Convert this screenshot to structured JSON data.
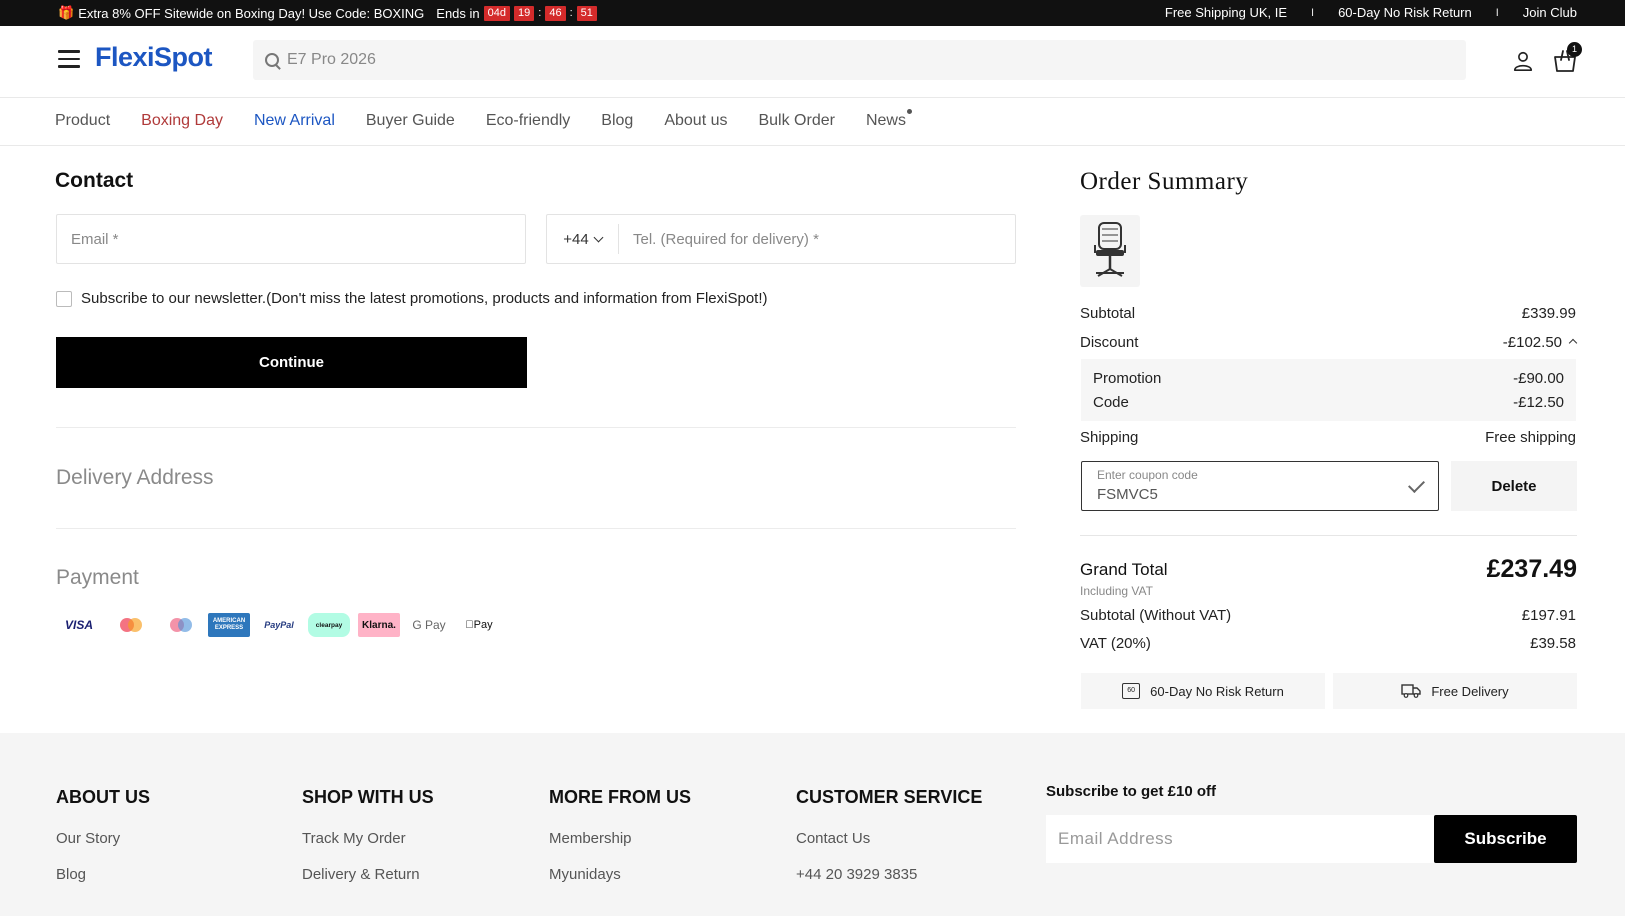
{
  "promo": {
    "gift_icon": "gift-icon",
    "text": "Extra 8% OFF Sitewide on Boxing Day! Use Code: BOXING",
    "ends_label": "Ends in",
    "timer": {
      "days": "04d",
      "hours": "19",
      "minutes": "46",
      "seconds": "51",
      "sep": ":"
    },
    "right_links": [
      "Free Shipping UK, IE",
      "60-Day No Risk Return",
      "Join Club"
    ],
    "pipe": "I"
  },
  "header": {
    "logo": "FlexiSpot",
    "search_placeholder": "E7 Pro 2026",
    "cart_count": "1"
  },
  "nav": {
    "items": [
      "Product",
      "Boxing Day",
      "New Arrival",
      "Buyer Guide",
      "Eco-friendly",
      "Blog",
      "About us",
      "Bulk Order",
      "News"
    ]
  },
  "contact": {
    "title": "Contact",
    "email_placeholder": "Email *",
    "country_code": "+44",
    "tel_placeholder": "Tel. (Required for delivery) *",
    "newsletter_text": "Subscribe to our newsletter.(Don't miss the latest promotions, products and information from FlexiSpot!)",
    "continue_label": "Continue"
  },
  "delivery": {
    "title": "Delivery Address"
  },
  "payment": {
    "title": "Payment",
    "methods": {
      "visa": "VISA",
      "amex": "AMERICAN EXPRESS",
      "paypal": "PayPal",
      "clearpay": "clearpay",
      "klarna": "Klarna.",
      "gpay": "G Pay",
      "apay": "Pay"
    }
  },
  "summary": {
    "title": "Order Summary",
    "subtotal_label": "Subtotal",
    "subtotal_value": "£339.99",
    "discount_label": "Discount",
    "discount_value": "-£102.50",
    "promotion_label": "Promotion",
    "promotion_value": "-£90.00",
    "code_label": "Code",
    "code_value": "-£12.50",
    "shipping_label": "Shipping",
    "shipping_value": "Free shipping",
    "coupon_label": "Enter coupon code",
    "coupon_value": "FSMVC5",
    "delete_label": "Delete",
    "grand_total_label": "Grand Total",
    "grand_total_value": "£237.49",
    "including_vat": "Including VAT",
    "subtotal_novat_label": "Subtotal (Without VAT)",
    "subtotal_novat_value": "£197.91",
    "vat_label": "VAT (20%)",
    "vat_value": "£39.58",
    "perk_return": "60-Day No Risk Return",
    "perk_return_badge": "60",
    "perk_delivery": "Free Delivery"
  },
  "footer": {
    "about": {
      "title": "ABOUT US",
      "links": [
        "Our Story",
        "Blog"
      ]
    },
    "shop": {
      "title": "SHOP WITH US",
      "links": [
        "Track My Order",
        "Delivery & Return"
      ]
    },
    "more": {
      "title": "MORE FROM US",
      "links": [
        "Membership",
        "Myunidays"
      ]
    },
    "service": {
      "title": "CUSTOMER SERVICE",
      "links": [
        "Contact Us",
        "+44 20 3929 3835"
      ]
    },
    "subscribe_title": "Subscribe to get £10 off",
    "subscribe_placeholder": "Email Address",
    "subscribe_button": "Subscribe"
  }
}
